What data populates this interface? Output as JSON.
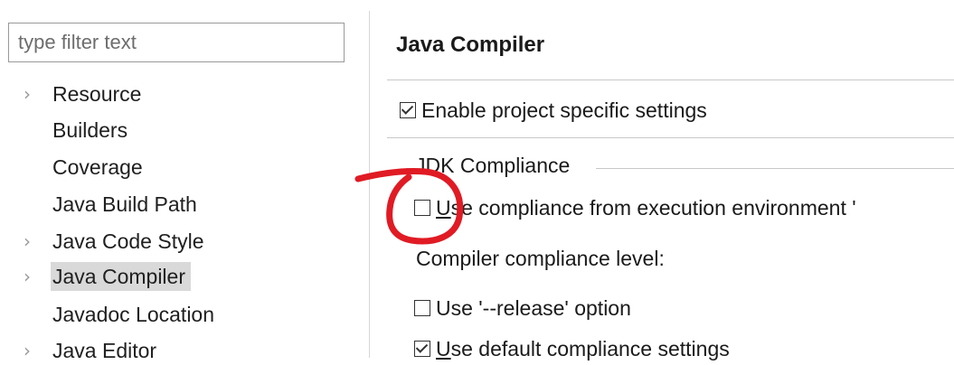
{
  "sidebar": {
    "filter_placeholder": "type filter text",
    "items": [
      {
        "label": "Resource",
        "expandable": true
      },
      {
        "label": "Builders",
        "expandable": false
      },
      {
        "label": "Coverage",
        "expandable": false
      },
      {
        "label": "Java Build Path",
        "expandable": false
      },
      {
        "label": "Java Code Style",
        "expandable": true
      },
      {
        "label": "Java Compiler",
        "expandable": true,
        "selected": true
      },
      {
        "label": "Javadoc Location",
        "expandable": false
      },
      {
        "label": "Java Editor",
        "expandable": true
      }
    ]
  },
  "main": {
    "title": "Java Compiler",
    "enable_project_specific": {
      "label": "Enable project specific settings",
      "checked": true
    },
    "jdk_group_label": "JDK Compliance",
    "use_ee_compliance": {
      "mnemonic": "U",
      "label_rest": "se compliance from execution environment '",
      "checked": false
    },
    "compliance_level_label": "Compiler compliance level:",
    "use_release": {
      "label": "Use '--release' option",
      "checked": false
    },
    "use_default": {
      "mnemonic": "U",
      "label_rest": "se default compliance settings",
      "checked": true
    }
  },
  "annotation": {
    "color": "#e01b24",
    "type": "hand-drawn circle around checkbox"
  }
}
